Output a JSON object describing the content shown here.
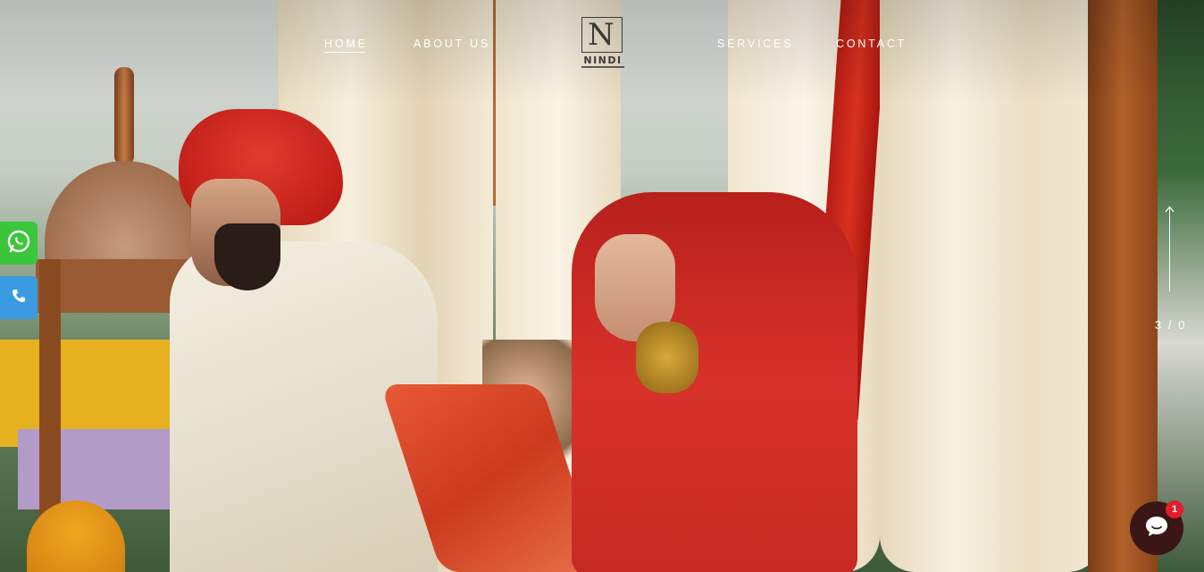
{
  "nav": {
    "items": [
      {
        "label": "HOME",
        "active": true
      },
      {
        "label": "ABOUT US",
        "active": false
      },
      {
        "label": "SERVICES",
        "active": false
      },
      {
        "label": "CONTACT",
        "active": false
      }
    ]
  },
  "logo": {
    "mark": "N",
    "wordmark": "NINDI"
  },
  "side_buttons": [
    {
      "icon": "whatsapp-icon",
      "color": "#3bc63b"
    },
    {
      "icon": "phone-icon",
      "color": "#3a9be0"
    }
  ],
  "slider": {
    "counter": "3 / 0"
  },
  "chat": {
    "icon": "chat-bubble-icon",
    "badge": "1",
    "color": "#3b1616",
    "badge_color": "#e01e2d"
  }
}
